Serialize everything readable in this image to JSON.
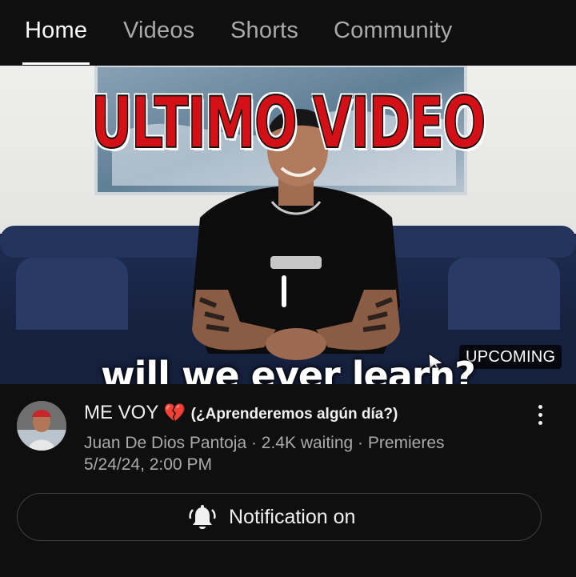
{
  "tabs": [
    {
      "label": "Home",
      "active": true
    },
    {
      "label": "Videos",
      "active": false
    },
    {
      "label": "Shorts",
      "active": false
    },
    {
      "label": "Community",
      "active": false
    }
  ],
  "thumbnail": {
    "headline": "ULTIMO VIDEO",
    "caption": "will we ever learn?",
    "badge": "UPCOMING"
  },
  "video": {
    "title_main": "ME VOY",
    "title_emoji": "💔",
    "title_sub": "(¿Aprenderemos algún día?)",
    "channel_line": "Juan De Dios Pantoja · 2.4K waiting · Premieres",
    "date_line": "5/24/24, 2:00 PM"
  },
  "notification_button": {
    "label": "Notification on",
    "icon": "bell-ringing-icon"
  },
  "colors": {
    "background": "#0f0f0f",
    "accent_red": "#d31016",
    "secondary_text": "#aaaaaa"
  }
}
